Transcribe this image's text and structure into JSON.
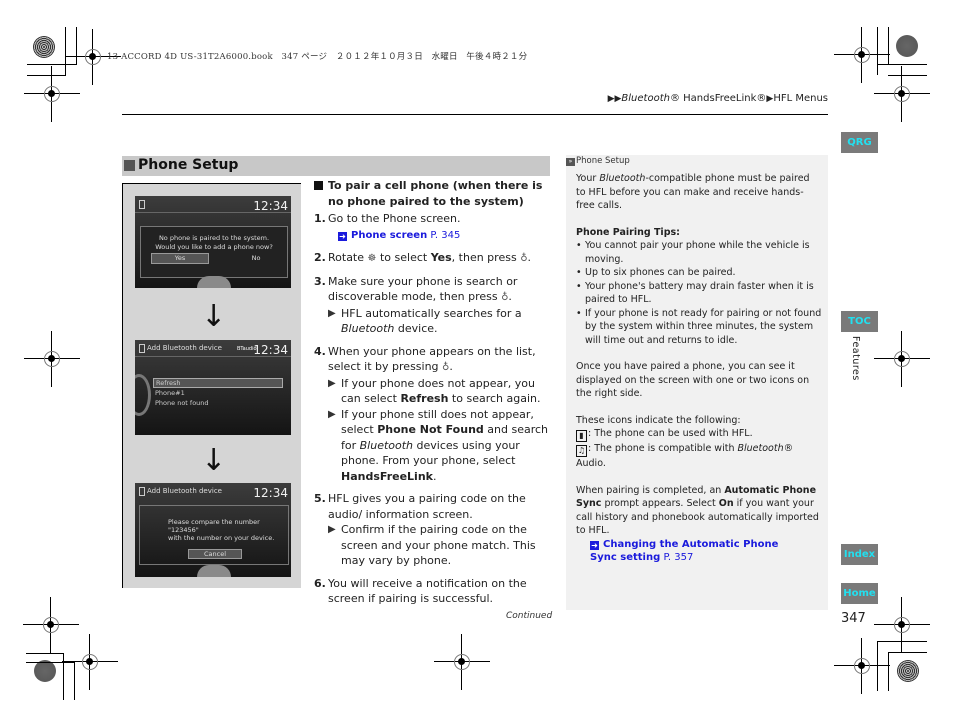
{
  "print_meta": "13 ACCORD 4D US-31T2A6000.book　347 ページ　２０１２年１０月３日　水曜日　午後４時２１分",
  "breadcrumb": {
    "separator": "▶",
    "items": [
      "Bluetooth",
      "® HandsFreeLink®",
      "HFL Menus"
    ]
  },
  "side_tabs": {
    "qrg": "QRG",
    "toc": "TOC",
    "index": "Index",
    "home": "Home",
    "section_label": "Features"
  },
  "page_number": "347",
  "section_title": "Phone Setup",
  "figure": {
    "screen1": {
      "clock": "12:34",
      "message_line1": "No phone is paired to the system.",
      "message_line2": "Would you like to add a phone now?",
      "yes": "Yes",
      "no": "No"
    },
    "screen2": {
      "title": "Add Bluetooth device",
      "badge": "BTaudio",
      "clock": "12:34",
      "items": [
        "Refresh",
        "Phone#1",
        "Phone not found"
      ]
    },
    "screen3": {
      "title": "Add Bluetooth device",
      "clock": "12:34",
      "line1": "Please compare the number",
      "line2": "\"123456\"",
      "line3": "with the number on your device.",
      "cancel": "Cancel"
    },
    "arrow": "↓"
  },
  "procedure": {
    "heading": "To pair a cell phone (when there is no phone paired to the system)",
    "steps": [
      {
        "num": "1.",
        "text": "Go to the Phone screen.",
        "link_label": "Phone screen",
        "link_page": "P. 345"
      },
      {
        "num": "2.",
        "pre": "Rotate ",
        "mid": " to select ",
        "bold": "Yes",
        "post": ", then press "
      },
      {
        "num": "3.",
        "text": "Make sure your phone is search or discoverable mode, then press ",
        "sub": [
          "HFL automatically searches for a ",
          "Bluetooth",
          " device."
        ]
      },
      {
        "num": "4.",
        "text": "When your phone appears on the list, select it by pressing ",
        "sub1": [
          "If your phone does not appear, you can select ",
          "Refresh",
          " to search again."
        ],
        "sub2": [
          "If your phone still does not appear, select ",
          "Phone Not Found",
          " and search for ",
          "Bluetooth",
          " devices using your phone. From your phone, select ",
          "HandsFreeLink",
          "."
        ]
      },
      {
        "num": "5.",
        "text": "HFL gives you a pairing code on the audio/ information screen.",
        "sub": "Confirm if the pairing code on the screen and your phone match. This may vary by phone."
      },
      {
        "num": "6.",
        "text": "You will receive a notification on the screen if pairing is successful."
      }
    ],
    "continued": "Continued"
  },
  "note": {
    "header": "Phone Setup",
    "intro": [
      "Your ",
      "Bluetooth",
      "-compatible phone must be paired to HFL before you can make and receive hands-free calls."
    ],
    "tips_heading": "Phone Pairing Tips:",
    "tips": [
      "You cannot pair your phone while the vehicle is moving.",
      "Up to six phones can be paired.",
      "Your phone's battery may drain faster when it is paired to HFL.",
      "If your phone is not ready for pairing or not found by the system within three minutes, the system will time out and returns to idle."
    ],
    "paired_text": "Once you have paired a phone, you can see it displayed on the screen with one or two icons on the right side.",
    "icons_intro": "These icons indicate the following:",
    "icon1_text": ": The phone can be used with HFL.",
    "icon2_pre": ": The phone is compatible with ",
    "icon2_italic": "Bluetooth",
    "icon2_post": "® Audio.",
    "sync_text": [
      "When pairing is completed, an ",
      "Automatic Phone Sync",
      " prompt appears. Select ",
      "On",
      " if you want your call history and phonebook automatically imported to HFL."
    ],
    "link_label": "Changing the Automatic Phone Sync setting",
    "link_page": "P. 357"
  }
}
